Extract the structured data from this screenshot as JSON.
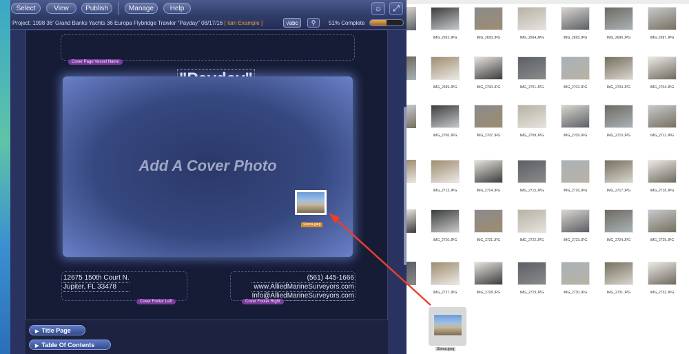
{
  "toolbar": {
    "select": "Select",
    "view": "View",
    "publish": "Publish",
    "manage": "Manage",
    "help": "Help"
  },
  "project": {
    "prefix": "Project:",
    "title": "1998 36' Grand Banks Yachts 36 Europa Flybridge Trawler \"Payday\" 08/17/16",
    "example_tag": "[ Iam Example ]",
    "spellcheck_label": "√abc",
    "progress_text": "51% Complete",
    "progress_value": 0.51
  },
  "cover": {
    "vessel_name": "\"Payday\"",
    "vessel_name_tag": "Cover Page Vessel Name",
    "photo_placeholder": "Add A Cover Photo",
    "dragged_file_name": "Sirena.jpeg",
    "footer_left_lines": [
      "12675 150th Court N.",
      "Jupiter, FL 33478"
    ],
    "footer_left_tag": "Cover Footer Left",
    "footer_right_lines": [
      "(561) 445-1666",
      "www.AlliedMarineSurveyors.com",
      "Info@AlliedMarineSurveyors.com"
    ],
    "footer_right_tag": "Cover Footer Right"
  },
  "sections": [
    "Title Page",
    "Table Of Contents"
  ],
  "finder": {
    "rows": [
      [
        "IMG_2692.JPG",
        "IMG_2693.JPG",
        "IMG_2694.JPG",
        "IMG_2695.JPG",
        "IMG_2696.JPG",
        "IMG_2697.JPG"
      ],
      [
        "IMG_2699.JPG",
        "IMG_2700.JPG",
        "IMG_2701.JPG",
        "IMG_2702.JPG",
        "IMG_2703.JPG",
        "IMG_2704.JPG"
      ],
      [
        "IMG_2706.JPG",
        "IMG_2707.JPG",
        "IMG_2708.JPG",
        "IMG_2709.JPG",
        "IMG_2710.JPG",
        "IMG_2711.JPG"
      ],
      [
        "IMG_2713.JPG",
        "IMG_2714.JPG",
        "IMG_2715.JPG",
        "IMG_2716.JPG",
        "IMG_2717.JPG",
        "IMG_2718.JPG"
      ],
      [
        "IMG_2720.JPG",
        "IMG_2721.JPG",
        "IMG_2722.JPG",
        "IMG_2723.JPG",
        "IMG_2724.JPG",
        "IMG_2725.JPG"
      ],
      [
        "IMG_2727.JPG",
        "IMG_2728.JPG",
        "IMG_2729.JPG",
        "IMG_2730.JPG",
        "IMG_2731.JPG",
        "IMG_2732.JPG"
      ]
    ],
    "dragged_file": "Sirena.jpeg"
  }
}
